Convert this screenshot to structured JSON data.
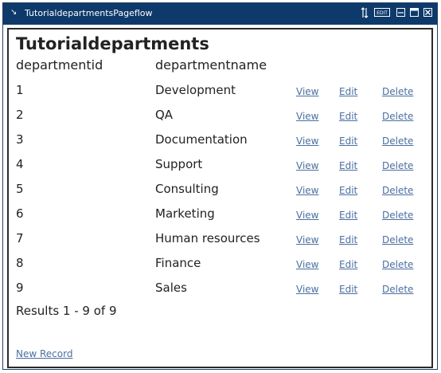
{
  "window": {
    "title": "TutorialdepartmentsPageflow",
    "controls": [
      "sort-icon",
      "edit-mode-icon",
      "minimize-icon",
      "maximize-icon",
      "close-icon"
    ]
  },
  "page": {
    "title": "Tutorialdepartments",
    "columns": {
      "id": "departmentid",
      "name": "departmentname"
    },
    "rows": [
      {
        "id": "1",
        "name": "Development",
        "view": "View",
        "edit": "Edit",
        "delete": "Delete"
      },
      {
        "id": "2",
        "name": "QA",
        "view": "View",
        "edit": "Edit",
        "delete": "Delete"
      },
      {
        "id": "3",
        "name": "Documentation",
        "view": "View",
        "edit": "Edit",
        "delete": "Delete"
      },
      {
        "id": "4",
        "name": "Support",
        "view": "View",
        "edit": "Edit",
        "delete": "Delete"
      },
      {
        "id": "5",
        "name": "Consulting",
        "view": "View",
        "edit": "Edit",
        "delete": "Delete"
      },
      {
        "id": "6",
        "name": "Marketing",
        "view": "View",
        "edit": "Edit",
        "delete": "Delete"
      },
      {
        "id": "7",
        "name": "Human resources",
        "view": "View",
        "edit": "Edit",
        "delete": "Delete"
      },
      {
        "id": "8",
        "name": "Finance",
        "view": "View",
        "edit": "Edit",
        "delete": "Delete"
      },
      {
        "id": "9",
        "name": "Sales",
        "view": "View",
        "edit": "Edit",
        "delete": "Delete"
      }
    ],
    "results": "Results 1 - 9 of 9",
    "new_record": "New Record"
  },
  "colors": {
    "titlebar": "#0d3a6b",
    "link": "#4a6fa0",
    "text": "#222222"
  }
}
